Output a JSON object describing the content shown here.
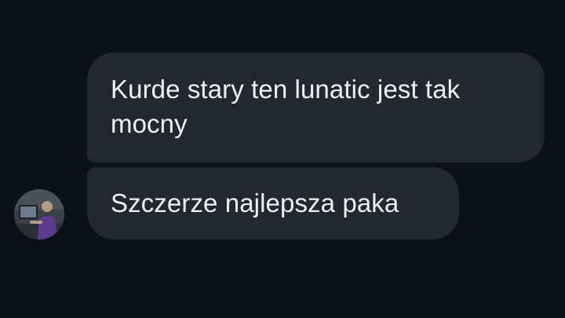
{
  "conversation": {
    "messages": [
      {
        "text": "Kurde stary ten lunatic jest tak mocny"
      },
      {
        "text": "Szczerze najlepsza paka"
      }
    ]
  },
  "colors": {
    "background": "#0c1118",
    "bubble": "#23272e",
    "text": "#eef0f3"
  }
}
